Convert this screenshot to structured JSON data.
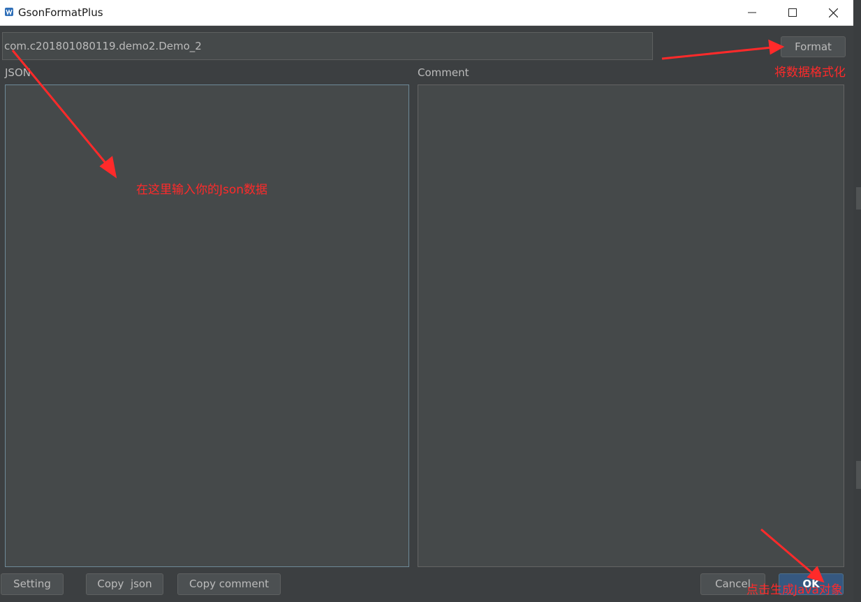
{
  "window": {
    "title": "GsonFormatPlus",
    "buttons": {
      "minimize": "minimize",
      "maximize": "maximize",
      "close": "close"
    }
  },
  "class_name_input": {
    "value": "com.c201801080119.demo2.Demo_2"
  },
  "format_button": {
    "label": "Format"
  },
  "json_panel": {
    "label": "JSON",
    "value": ""
  },
  "comment_panel": {
    "label": "Comment",
    "value": ""
  },
  "bottom_bar": {
    "setting_label": "Setting",
    "copy_json_label": "Copy  json",
    "copy_comment_label": "Copy comment",
    "cancel_label": "Cancel",
    "ok_label": "OK"
  },
  "annotations": {
    "json_hint": "在这里输入你的Json数据",
    "format_hint": "将数据格式化",
    "ok_hint": "点击生成Java对象",
    "color": "#ff2a2a"
  },
  "colors": {
    "background": "#3c3f41",
    "field": "#45494a",
    "button": "#4c5052",
    "default_button": "#365880",
    "text": "#bbbbbb"
  }
}
